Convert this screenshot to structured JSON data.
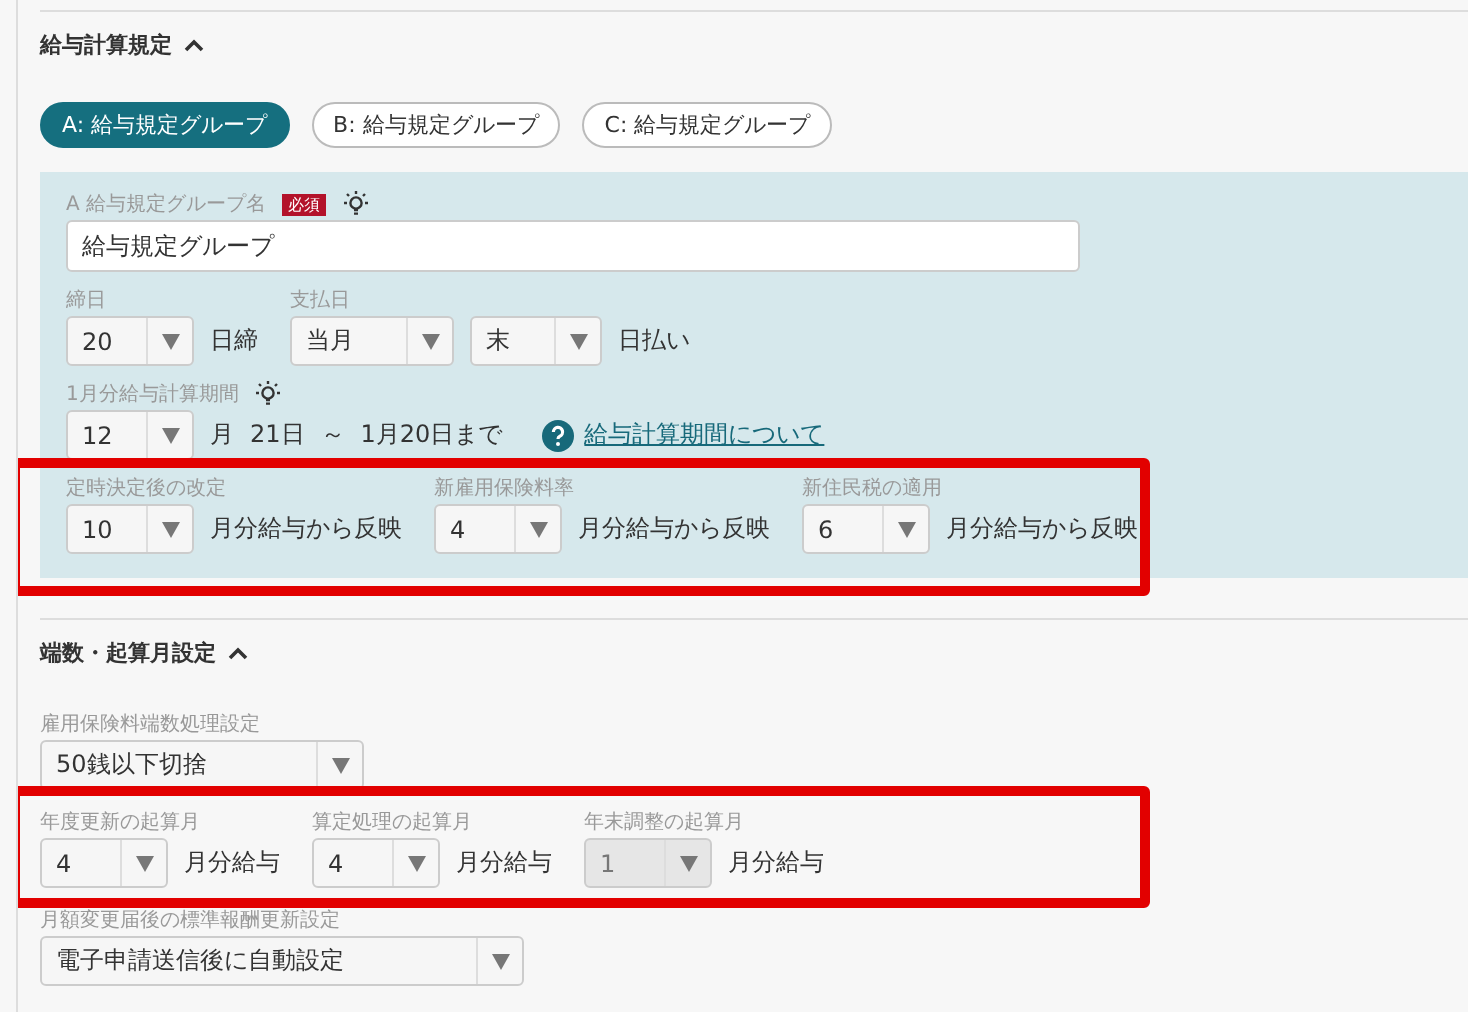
{
  "sections": [
    {
      "title": "給与計算規定",
      "expanded": true,
      "panel": true,
      "tabs": [
        {
          "label": "A: 給与規定グループ",
          "selected": true
        },
        {
          "label": "B: 給与規定グループ",
          "selected": false
        },
        {
          "label": "C: 給与規定グループ",
          "selected": false
        }
      ],
      "rows": [
        {
          "highlighted": false,
          "groups": [
            {
              "label": "A 給与規定グループ名",
              "required": "必須",
              "hint": true,
              "controls": [
                {
                  "kind": "input",
                  "value": "給与規定グループ"
                }
              ]
            }
          ]
        },
        {
          "highlighted": false,
          "groups": [
            {
              "label": "締日",
              "hint": false,
              "controls": [
                {
                  "kind": "select",
                  "value": "20",
                  "disabled": false
                },
                {
                  "kind": "text",
                  "text": "日締"
                }
              ]
            },
            {
              "label": "支払日",
              "hint": false,
              "controls": [
                {
                  "kind": "select",
                  "value": "当月",
                  "disabled": false
                },
                {
                  "kind": "select",
                  "value": "末",
                  "disabled": false
                },
                {
                  "kind": "text",
                  "text": "日払い"
                }
              ]
            }
          ]
        },
        {
          "highlighted": false,
          "groups": [
            {
              "label": "1月分給与計算期間",
              "hint": true,
              "controls": [
                {
                  "kind": "select",
                  "value": "12",
                  "disabled": false
                },
                {
                  "kind": "text",
                  "text": "月"
                },
                {
                  "kind": "text",
                  "text": "21日"
                },
                {
                  "kind": "text",
                  "text": "～"
                },
                {
                  "kind": "text",
                  "text": "1月20日まで"
                },
                {
                  "kind": "link",
                  "text": "給与計算期間について"
                }
              ]
            }
          ]
        },
        {
          "highlighted": true,
          "groups": [
            {
              "label": "定時決定後の改定",
              "hint": false,
              "controls": [
                {
                  "kind": "select",
                  "value": "10",
                  "disabled": false
                },
                {
                  "kind": "text",
                  "text": "月分給与から反映"
                }
              ]
            },
            {
              "label": "新雇用保険料率",
              "hint": false,
              "controls": [
                {
                  "kind": "select",
                  "value": "4",
                  "disabled": false
                },
                {
                  "kind": "text",
                  "text": "月分給与から反映"
                }
              ]
            },
            {
              "label": "新住民税の適用",
              "hint": false,
              "controls": [
                {
                  "kind": "select",
                  "value": "6",
                  "disabled": false
                },
                {
                  "kind": "text",
                  "text": "月分給与から反映"
                }
              ]
            }
          ]
        }
      ]
    },
    {
      "title": "端数・起算月設定",
      "expanded": true,
      "panel": false,
      "rows": [
        {
          "highlighted": false,
          "groups": [
            {
              "label": "雇用保険料端数処理設定",
              "hint": false,
              "controls": [
                {
                  "kind": "select",
                  "value": "50銭以下切捨",
                  "disabled": false
                }
              ]
            }
          ]
        },
        {
          "highlighted": true,
          "groups": [
            {
              "label": "年度更新の起算月",
              "hint": false,
              "controls": [
                {
                  "kind": "select",
                  "value": "4",
                  "disabled": false
                },
                {
                  "kind": "text",
                  "text": "月分給与"
                }
              ]
            },
            {
              "label": "算定処理の起算月",
              "hint": false,
              "controls": [
                {
                  "kind": "select",
                  "value": "4",
                  "disabled": false
                },
                {
                  "kind": "text",
                  "text": "月分給与"
                }
              ]
            },
            {
              "label": "年末調整の起算月",
              "hint": false,
              "controls": [
                {
                  "kind": "select",
                  "value": "1",
                  "disabled": true
                },
                {
                  "kind": "text",
                  "text": "月分給与"
                }
              ]
            }
          ]
        },
        {
          "highlighted": false,
          "groups": [
            {
              "label": "月額変更届後の標準報酬更新設定",
              "hint": false,
              "controls": [
                {
                  "kind": "select",
                  "value": "電子申請送信後に自動設定",
                  "disabled": false
                }
              ]
            }
          ]
        }
      ]
    }
  ]
}
